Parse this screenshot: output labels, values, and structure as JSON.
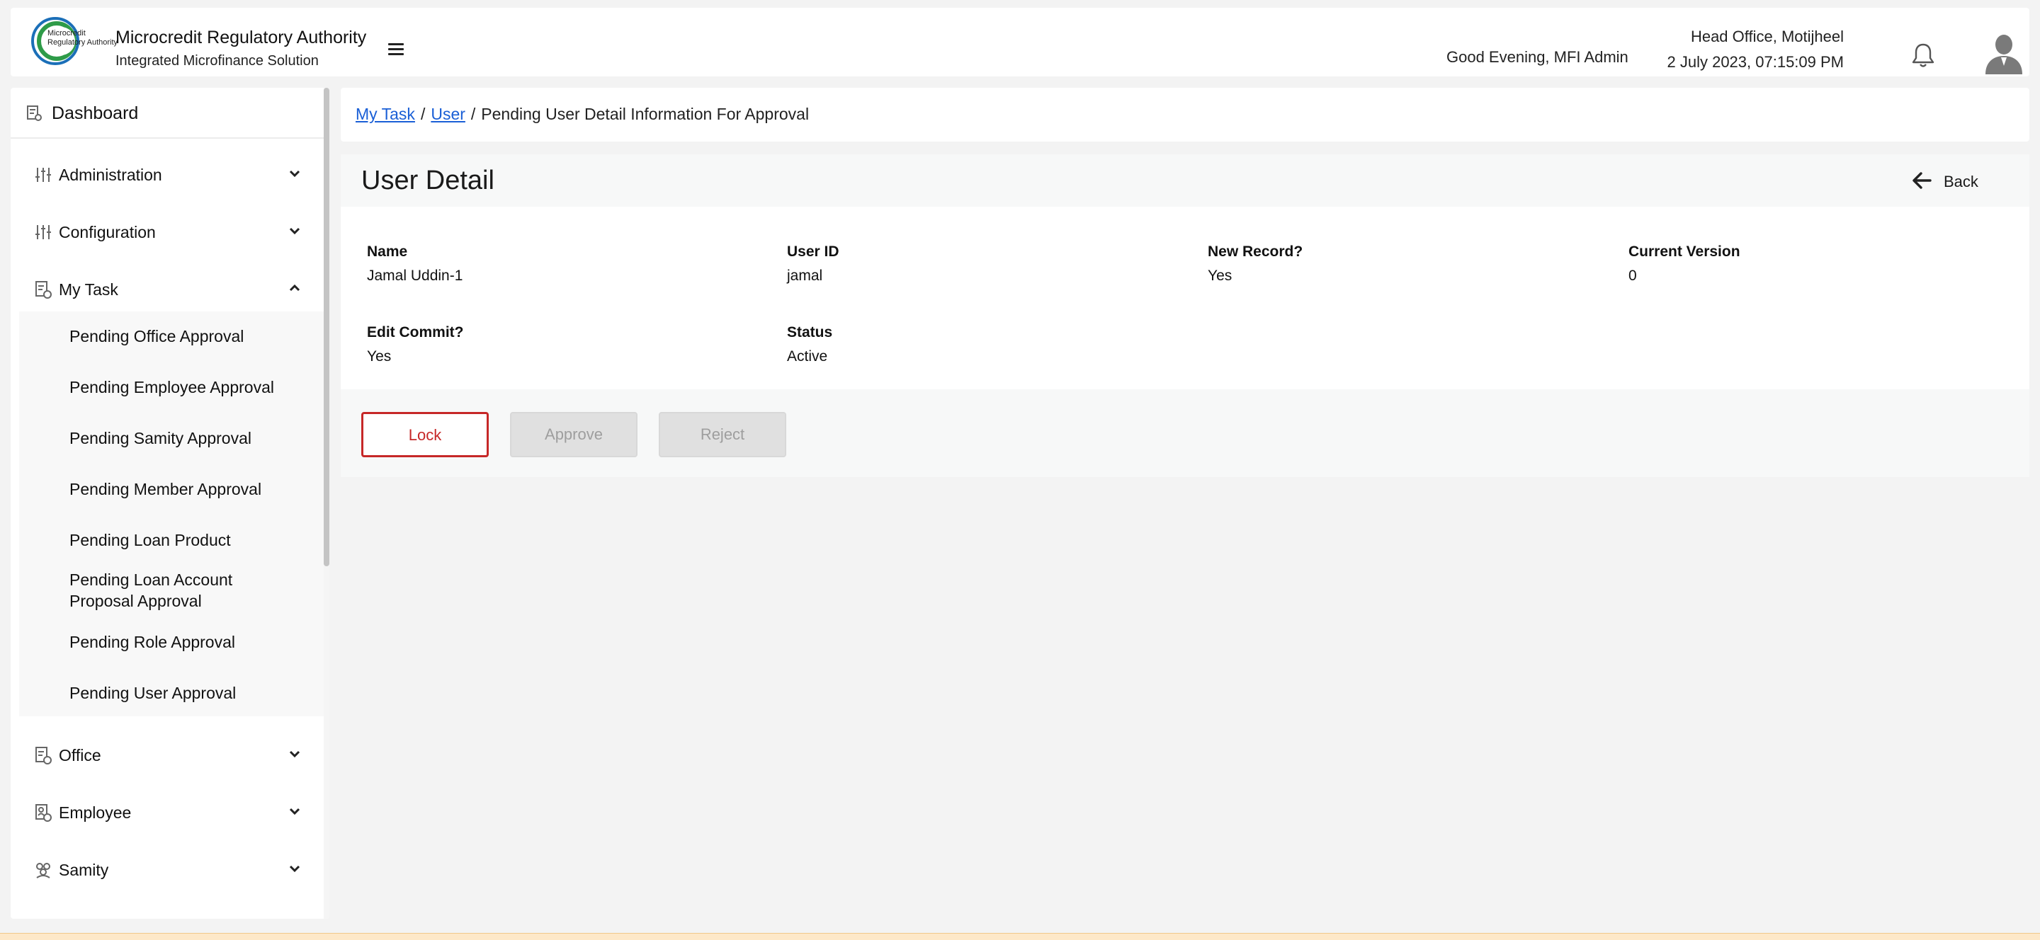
{
  "header": {
    "logo_text": "Microcredit Regulatory Authority",
    "org_name": "Microcredit Regulatory Authority",
    "org_subtitle": "Integrated Microfinance Solution",
    "greeting": "Good Evening, MFI Admin",
    "office": "Head Office, Motijheel",
    "datetime": "2 July 2023, 07:15:09 PM"
  },
  "sidebar": {
    "dashboard": "Dashboard",
    "sections": [
      {
        "label": "Administration",
        "expanded": false
      },
      {
        "label": "Configuration",
        "expanded": false
      },
      {
        "label": "My Task",
        "expanded": true
      },
      {
        "label": "Office",
        "expanded": false
      },
      {
        "label": "Employee",
        "expanded": false
      },
      {
        "label": "Samity",
        "expanded": false
      }
    ],
    "my_task_items": [
      "Pending Office Approval",
      "Pending Employee Approval",
      "Pending Samity Approval",
      "Pending Member Approval",
      "Pending Loan Product",
      "Pending Loan Account Proposal Approval",
      "Pending Role Approval",
      "Pending User Approval"
    ]
  },
  "breadcrumb": {
    "items": [
      "My Task",
      "User"
    ],
    "current": "Pending User Detail Information For Approval"
  },
  "detail": {
    "title": "User Detail",
    "back_label": "Back",
    "fields": [
      {
        "label": "Name",
        "value": "Jamal Uddin-1"
      },
      {
        "label": "User ID",
        "value": "jamal"
      },
      {
        "label": "New Record?",
        "value": "Yes"
      },
      {
        "label": "Current Version",
        "value": "0"
      },
      {
        "label": "Edit Commit?",
        "value": "Yes"
      },
      {
        "label": "Status",
        "value": "Active"
      }
    ]
  },
  "actions": {
    "lock": "Lock",
    "approve": "Approve",
    "reject": "Reject"
  },
  "colors": {
    "accent_link": "#1a5fd6",
    "lock_red": "#c62828",
    "logo_green": "#2e9b48",
    "logo_blue": "#1b6fb8"
  }
}
